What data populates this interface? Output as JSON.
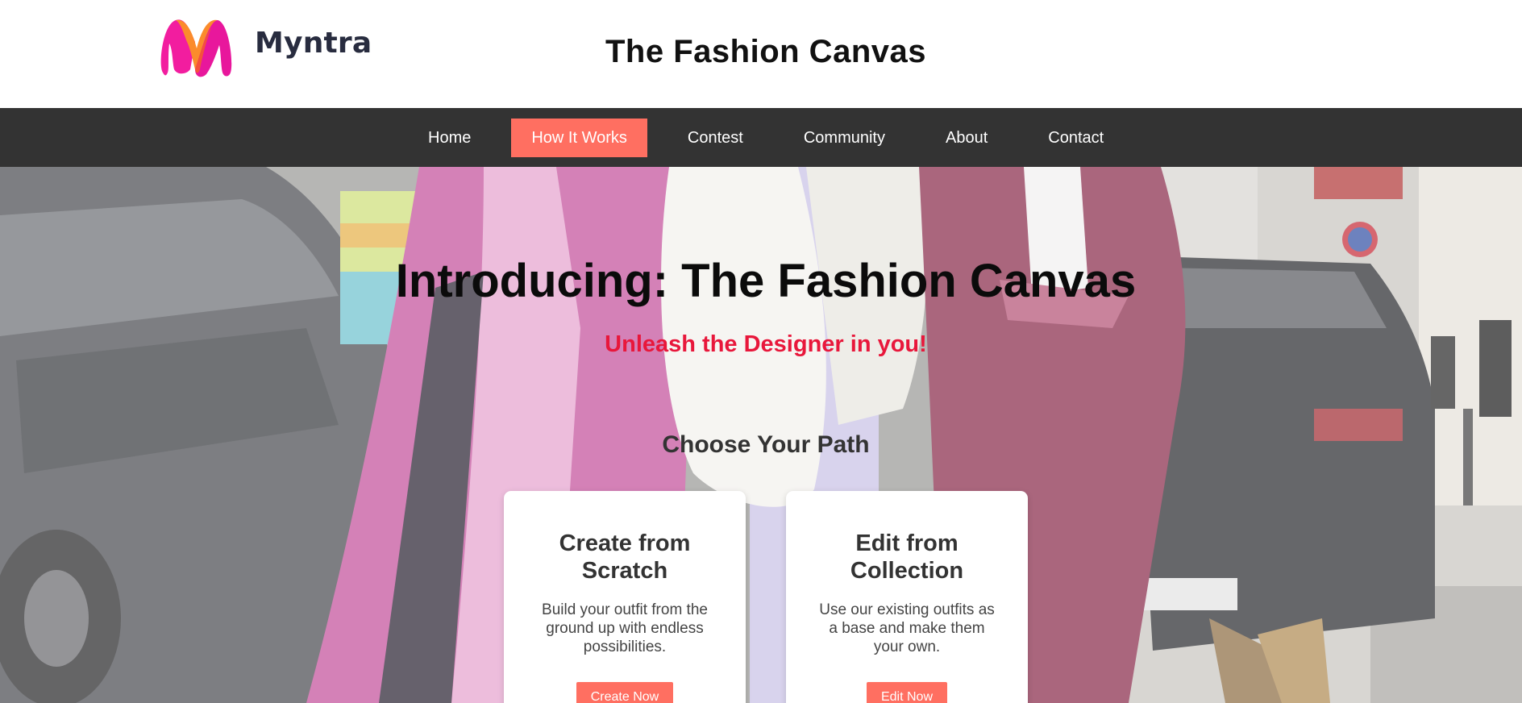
{
  "brand": {
    "name": "Myntra"
  },
  "header": {
    "title": "The Fashion Canvas"
  },
  "nav": {
    "items": [
      {
        "label": "Home",
        "active": false
      },
      {
        "label": "How It Works",
        "active": true
      },
      {
        "label": "Contest",
        "active": false
      },
      {
        "label": "Community",
        "active": false
      },
      {
        "label": "About",
        "active": false
      },
      {
        "label": "Contact",
        "active": false
      }
    ]
  },
  "hero": {
    "title": "Introducing: The Fashion Canvas",
    "subtitle": "Unleash the Designer in you!",
    "section_title": "Choose Your Path",
    "background": "street-fashion-photo"
  },
  "cards": [
    {
      "title": "Create from Scratch",
      "description": "Build your outfit from the ground up with endless possibilities.",
      "button": "Create Now"
    },
    {
      "title": "Edit from Collection",
      "description": "Use our existing outfits as a base and make them your own.",
      "button": "Edit Now"
    }
  ],
  "colors": {
    "accent": "#ff6f61",
    "nav_bg": "#333333",
    "subtitle": "#e8173b"
  }
}
